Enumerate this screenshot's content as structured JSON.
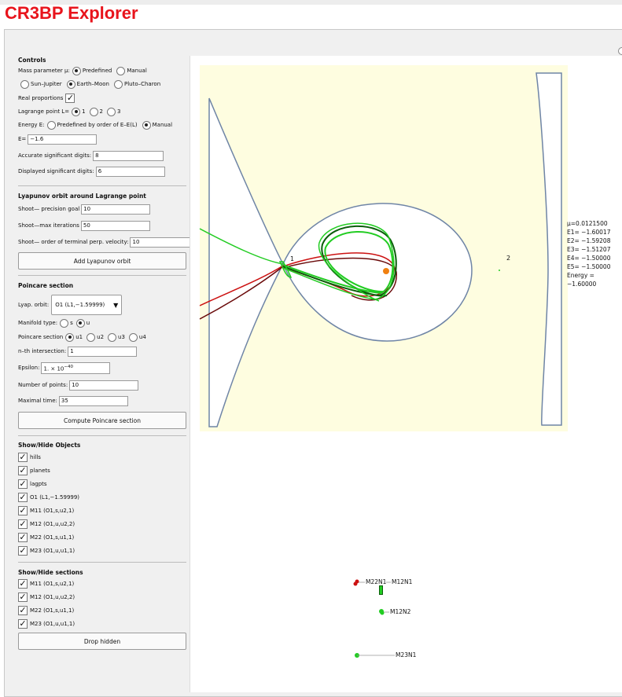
{
  "app": {
    "title": "CR3BP Explorer"
  },
  "controls": {
    "header": "Controls",
    "mass_label": "Mass parameter μ:",
    "mass_predefined": "Predefined",
    "mass_manual": "Manual",
    "sun_jupiter": "Sun–Jupiter",
    "earth_moon": "Earth–Moon",
    "pluto_charon": "Pluto–Charon",
    "real_proportions": "Real proportions",
    "lagrange_label": "Lagrange point L=",
    "l1": "1",
    "l2": "2",
    "l3": "3",
    "energy_label": "Energy E:",
    "energy_predefined": "Predefined by order of E–E(L)",
    "energy_manual": "Manual",
    "e_label": "E=",
    "e_value": "−1.6",
    "accurate_label": "Accurate significant digits:",
    "accurate_value": "8",
    "displayed_label": "Displayed significant digits:",
    "displayed_value": "6"
  },
  "lyapunov": {
    "header": "Lyapunov orbit around Lagrange point",
    "precision_label": "Shoot— precision goal",
    "precision_value": "10",
    "maxit_label": "Shoot—max iterations",
    "maxit_value": "50",
    "order_label": "Shoot— order of terminal perp. velocity:",
    "order_value": "10",
    "add_button": "Add Lyapunov orbit"
  },
  "poincare": {
    "header": "Poincare section",
    "orbit_label": "Lyap. orbit:",
    "orbit_value": "O1 (L1,−1.59999)",
    "manifold_label": "Manifold type:",
    "manifold_s": "s",
    "manifold_u": "u",
    "section_label": "Poincare section",
    "u1": "u1",
    "u2": "u2",
    "u3": "u3",
    "u4": "u4",
    "nth_label": "n–th intersection:",
    "nth_value": "1",
    "eps_label": "Epsilon:",
    "eps_value": "1. × 10",
    "eps_exp": "−40",
    "npoints_label": "Number of points:",
    "npoints_value": "10",
    "maxtime_label": "Maximal time:",
    "maxtime_value": "35",
    "compute_button": "Compute Poincare section"
  },
  "show_objects": {
    "header": "Show/Hide Objects",
    "items": [
      "hills",
      "planets",
      "lagpts",
      "O1 (L1,−1.59999)",
      "M11 (O1,s,u2,1)",
      "M12 (O1,u,u2,2)",
      "M22 (O1,s,u1,1)",
      "M23 (O1,u,u1,1)"
    ]
  },
  "show_sections": {
    "header": "Show/Hide sections",
    "items": [
      "M11 (O1,s,u2,1)",
      "M12 (O1,u,u2,2)",
      "M22 (O1,s,u1,1)",
      "M23 (O1,u,u1,1)"
    ],
    "drop_button": "Drop hidden"
  },
  "plot": {
    "l1_label": "1",
    "l2_label": "2",
    "params": [
      "μ=0.0121500",
      "E1= −1.60017",
      "E2= −1.59208",
      "E3= −1.51207",
      "E4= −1.50000",
      "E5= −1.50000",
      "Energy = −1.60000"
    ],
    "section_labels": [
      "M22N1",
      "M12N1",
      "M12N2",
      "M23N1"
    ],
    "colors": {
      "region": "#fefde0",
      "curve": "#6f85a6",
      "green": "#22cc22",
      "darkgreen": "#0b5e0b",
      "red": "#cc1111",
      "darkred": "#6a0a0a",
      "moon": "#f08010"
    }
  }
}
